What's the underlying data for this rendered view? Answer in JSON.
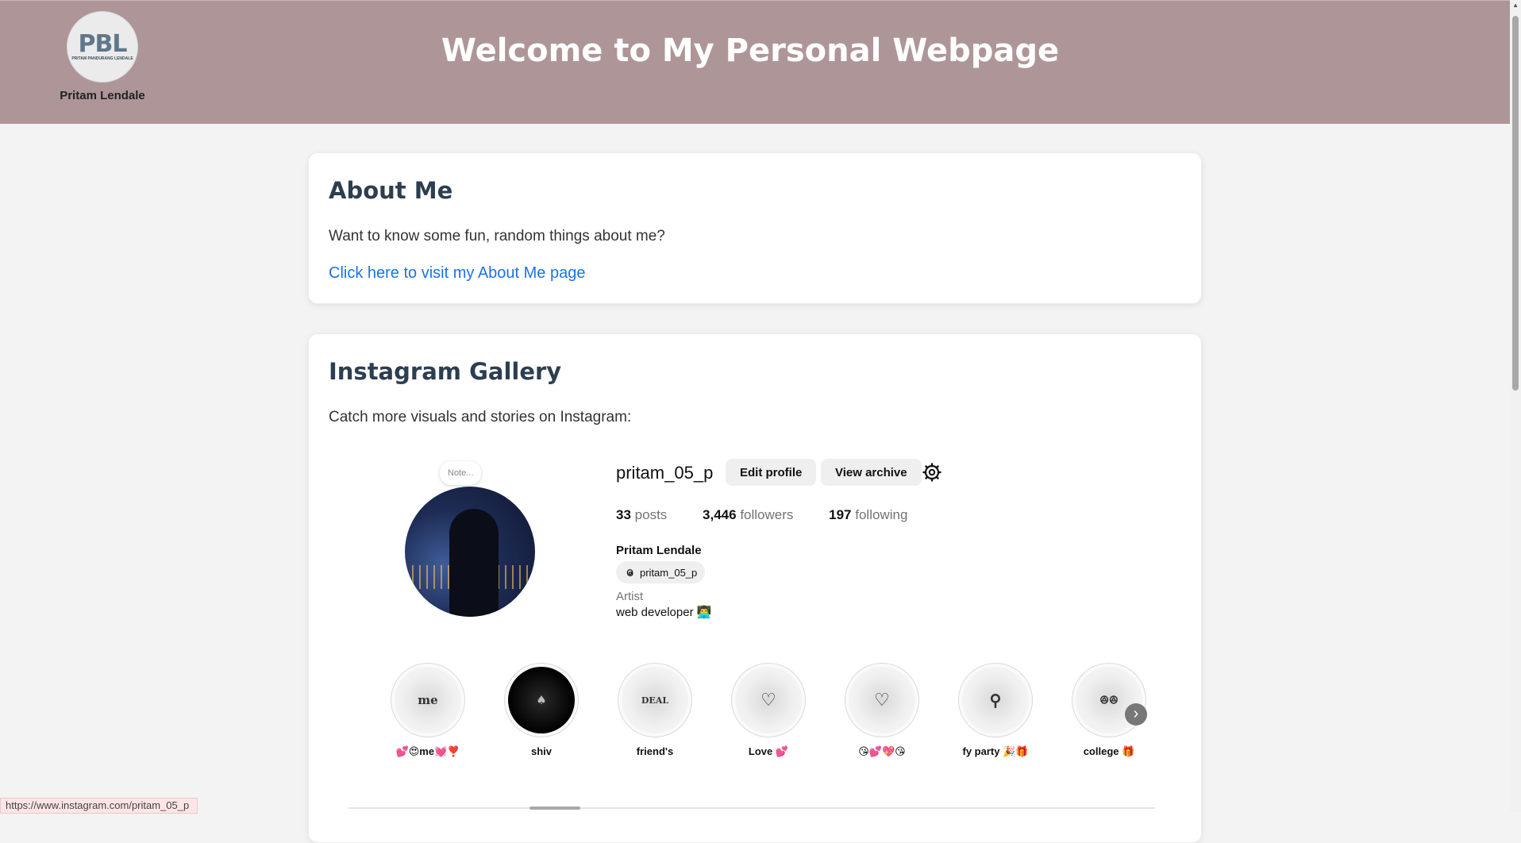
{
  "header": {
    "logo_text": "PBL",
    "logo_subtext": "PRITAM PANDURANG LENDALE",
    "logo_name": "Pritam Lendale",
    "title": "Welcome to My Personal Webpage"
  },
  "about": {
    "heading": "About Me",
    "text": "Want to know some fun, random things about me?",
    "link_text": "Click here to visit my About Me page"
  },
  "gallery": {
    "heading": "Instagram Gallery",
    "text": "Catch more visuals and stories on Instagram:",
    "profile": {
      "note": "Note...",
      "username": "pritam_05_p",
      "edit_label": "Edit profile",
      "archive_label": "View archive",
      "posts_count": "33",
      "posts_label": "posts",
      "followers_count": "3,446",
      "followers_label": "followers",
      "following_count": "197",
      "following_label": "following",
      "name": "Pritam Lendale",
      "threads_handle": "pritam_05_p",
      "category": "Artist",
      "bio": "web developer 👨‍💻"
    },
    "highlights": [
      {
        "cover": "me",
        "label": "💕😍me💓❣️"
      },
      {
        "cover": "♠",
        "label": "shiv"
      },
      {
        "cover": "DEAL",
        "label": "friend's"
      },
      {
        "cover": "♡",
        "label": "Love 💕"
      },
      {
        "cover": "♡",
        "label": "😘💕💖😘"
      },
      {
        "cover": "⚲",
        "label": "fy party 🎉🎁"
      },
      {
        "cover": "ꔮꔮ",
        "label": "college 🎁"
      }
    ]
  },
  "status_bar": {
    "url": "https://www.instagram.com/pritam_05_p"
  }
}
